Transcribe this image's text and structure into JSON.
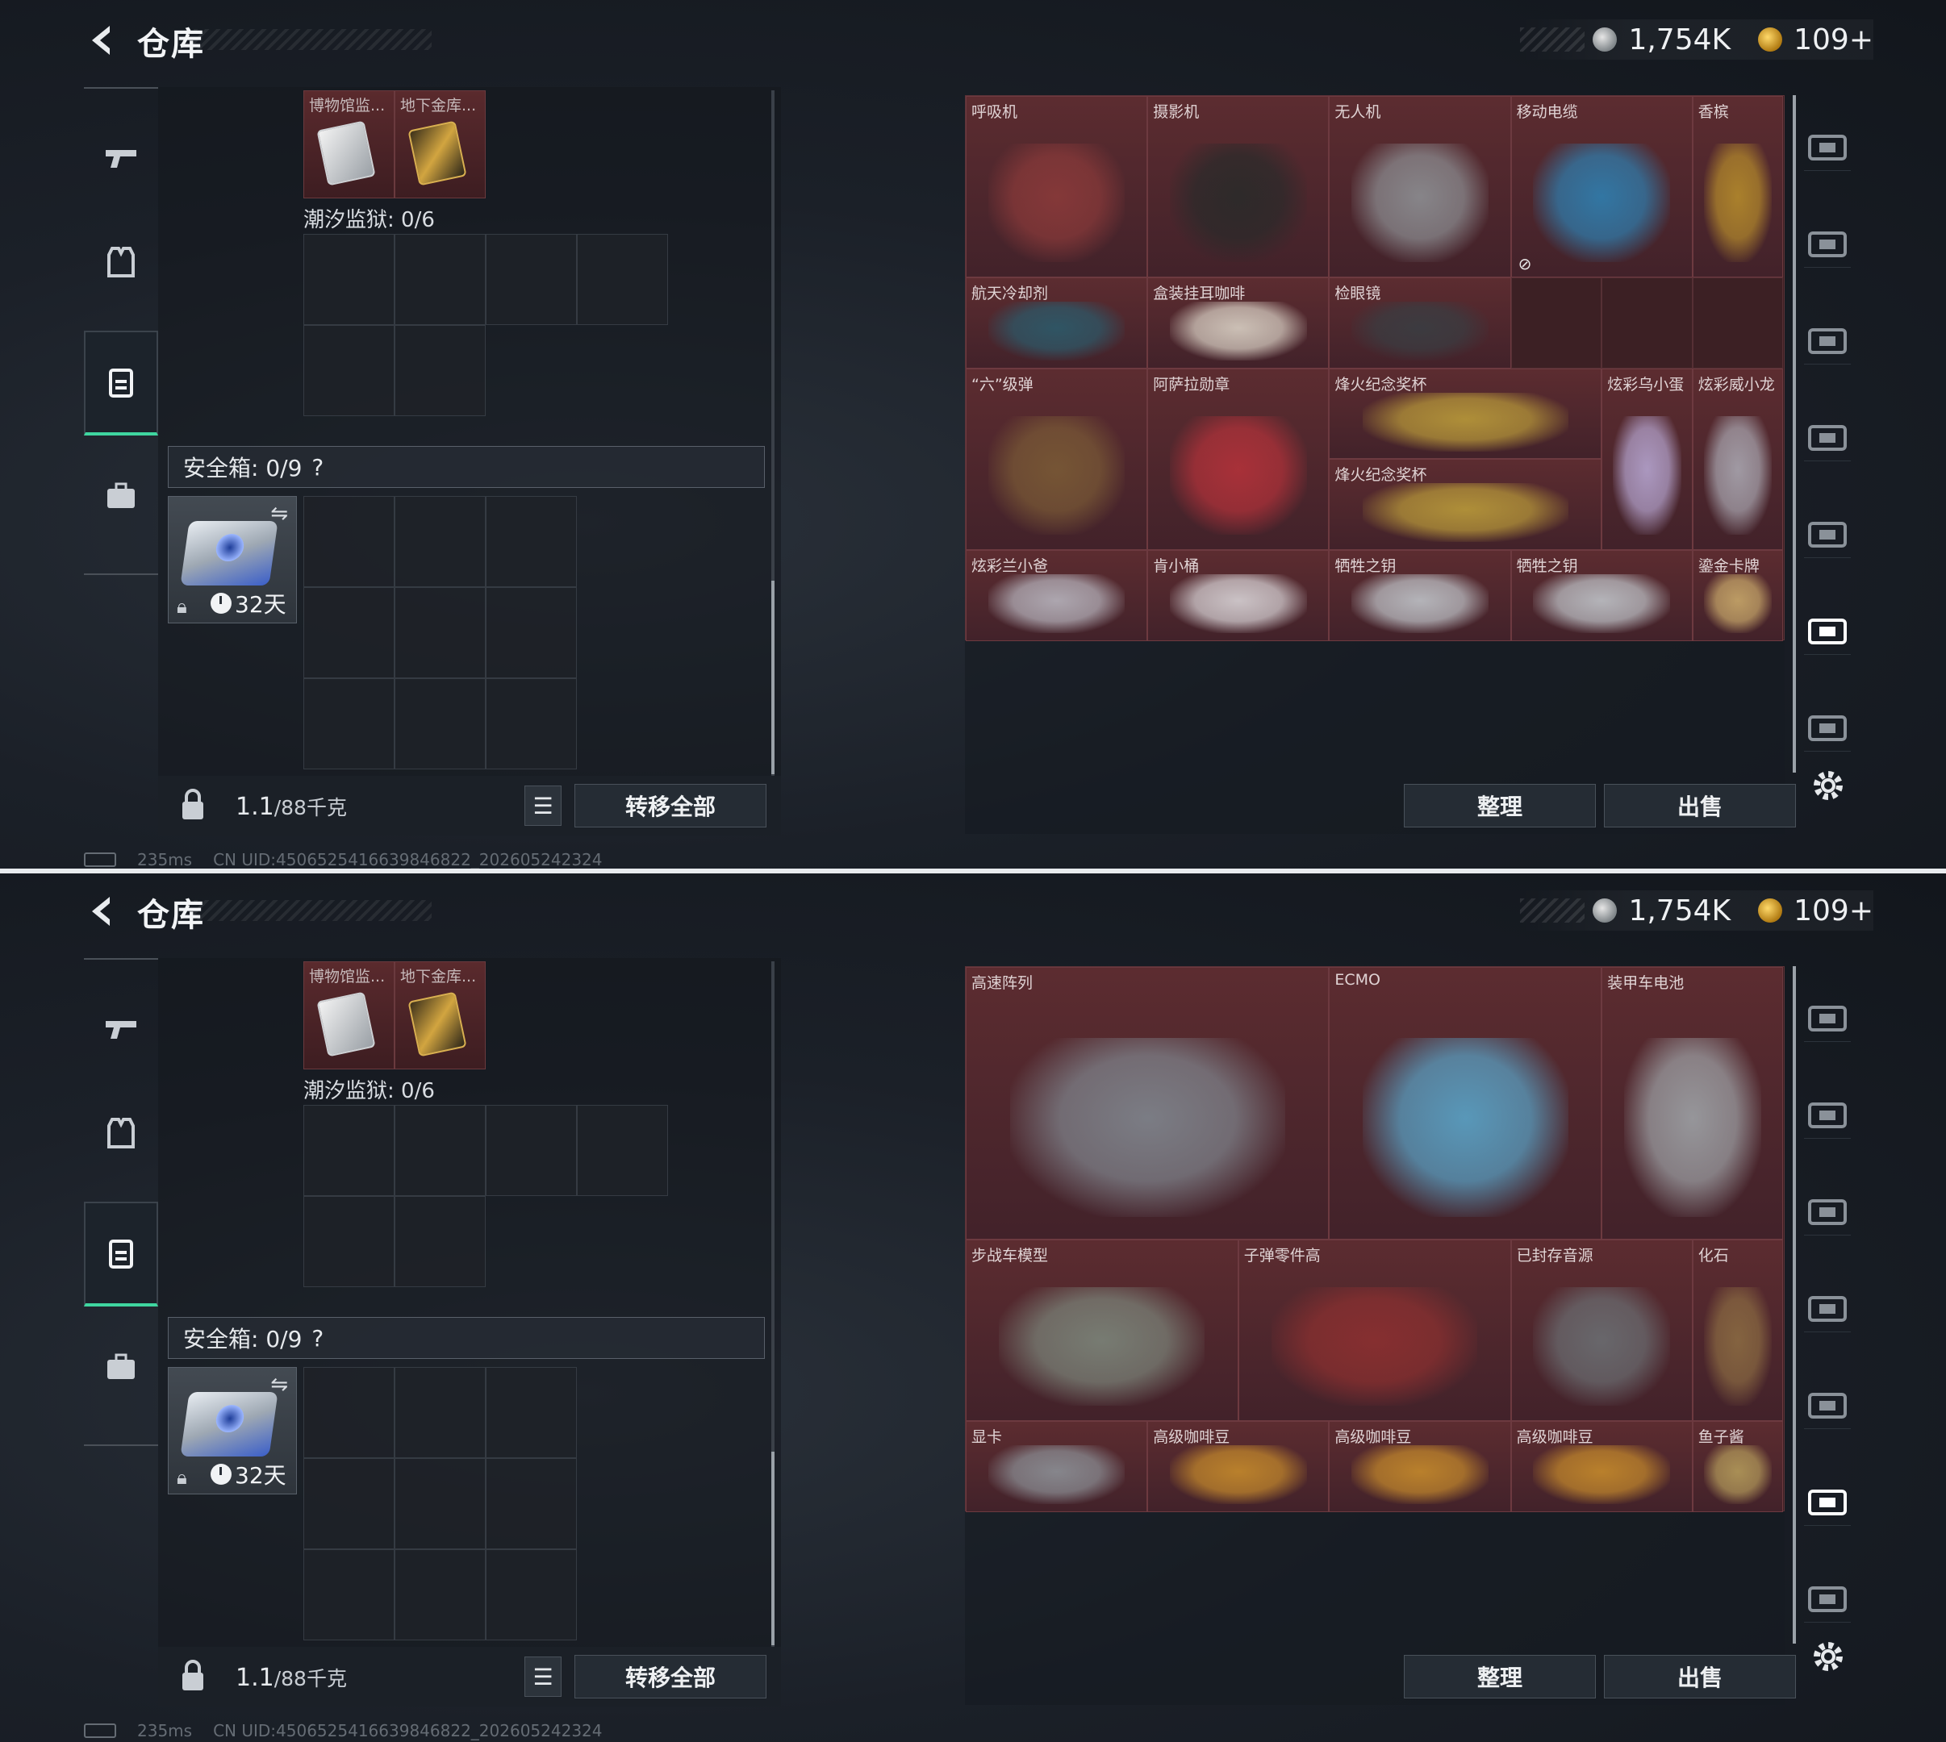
{
  "header": {
    "title": "仓库",
    "silver": "1,754K",
    "gold": "109+"
  },
  "left": {
    "top_tiles": [
      {
        "label": "博物馆监..."
      },
      {
        "label": "地下金库..."
      }
    ],
    "section1": "潮汐监狱: 0/6",
    "safe_label": "安全箱: 0/9",
    "safe_help": "?",
    "safe_timer": "32天",
    "weight": "1.1",
    "weight_cap": "/88千克",
    "transfer_all": "转移全部"
  },
  "status": {
    "ping": "235ms",
    "uid": "CN UID:4506525416639846822_202605242324"
  },
  "buttons": {
    "sort": "整理",
    "sell": "出售"
  },
  "top_items": [
    {
      "label": "呼吸机",
      "color": "#8a3a3a"
    },
    {
      "label": "摄影机",
      "color": "#2a2a2a"
    },
    {
      "label": "无人机",
      "color": "#8d8f93"
    },
    {
      "label": "移动电缆",
      "color": "#2f7fb0"
    },
    {
      "label": "香槟",
      "color": "#b48a2c"
    },
    {
      "label": "航天冷却剂",
      "color": "#2c5a6a"
    },
    {
      "label": "盒装挂耳咖啡",
      "color": "#d9d0c4"
    },
    {
      "label": "检眼镜",
      "color": "#3a3d42"
    },
    {
      "label": "“六”级弹",
      "color": "#7a5a36"
    },
    {
      "label": "阿萨拉勋章",
      "color": "#b2323a"
    },
    {
      "label": "烽火纪念奖杯",
      "color": "#b99a3a"
    },
    {
      "label": "烽火纪念奖杯",
      "color": "#b99a3a"
    },
    {
      "label": "炫彩乌小蛋",
      "color": "#b5a4cf"
    },
    {
      "label": "炫彩威小龙",
      "color": "#a9a6b0"
    },
    {
      "label": "炫彩兰小爸",
      "color": "#b7b4bd"
    },
    {
      "label": "肯小桶",
      "color": "#d8d3d6"
    },
    {
      "label": "牺牲之钥",
      "color": "#bfc3c8"
    },
    {
      "label": "牺牲之钥",
      "color": "#bfc3c8"
    },
    {
      "label": "鎏金卡牌",
      "color": "#c8a86a"
    }
  ],
  "bottom_items": [
    {
      "label": "高速阵列",
      "color": "#80868e"
    },
    {
      "label": "ECMO",
      "color": "#5aa4c8"
    },
    {
      "label": "装甲车电池",
      "color": "#9ea2a6"
    },
    {
      "label": "步战车模型",
      "color": "#7c857a"
    },
    {
      "label": "子弹零件高",
      "color": "#8c3030"
    },
    {
      "label": "已封存音源",
      "color": "#6b6e72"
    },
    {
      "label": "化石",
      "color": "#8a6a42"
    },
    {
      "label": "显卡",
      "color": "#8c9096"
    },
    {
      "label": "高级咖啡豆",
      "color": "#c58a2c"
    },
    {
      "label": "高级咖啡豆",
      "color": "#c58a2c"
    },
    {
      "label": "高级咖啡豆",
      "color": "#c58a2c"
    },
    {
      "label": "鱼子酱",
      "color": "#b39a5a"
    }
  ],
  "rail_icons": [
    "home-icon",
    "medkit-add-icon",
    "ammo-box-icon",
    "rifle-rack-icon",
    "tier4-case-icon",
    "tier4-gear-icon",
    "tier4-crate-icon"
  ]
}
